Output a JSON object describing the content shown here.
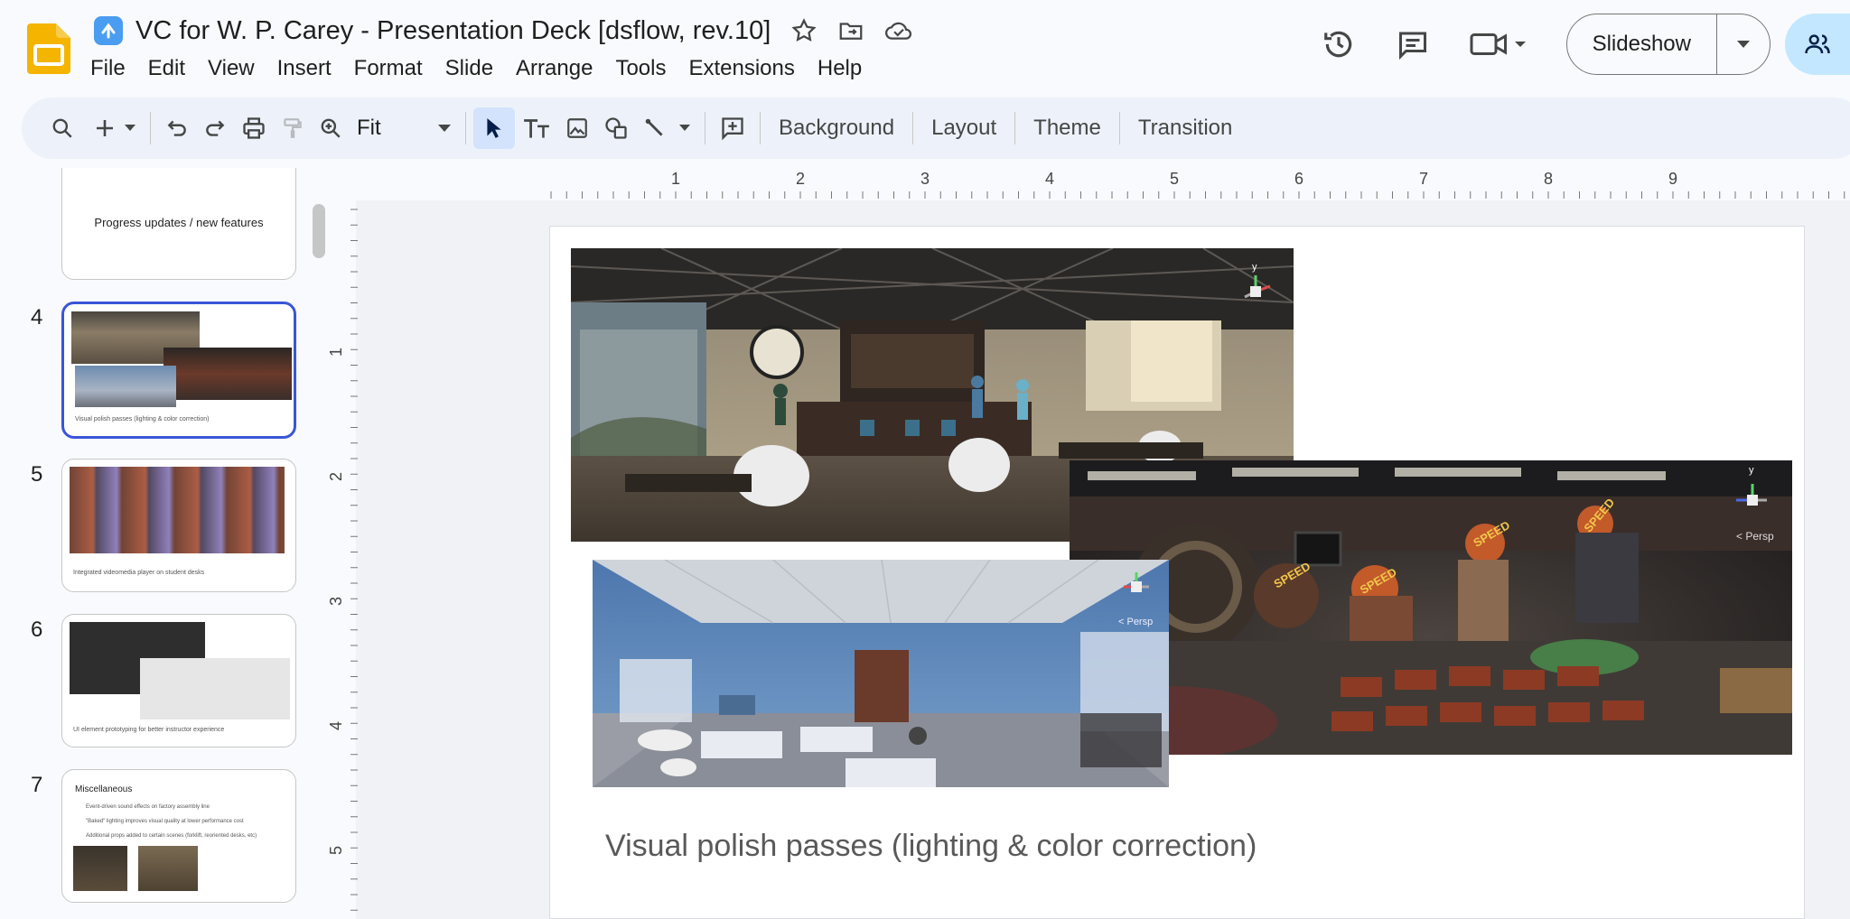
{
  "document": {
    "title": "VC for W. P. Carey - Presentation Deck [dsflow, rev.10]"
  },
  "menu": [
    "File",
    "Edit",
    "View",
    "Insert",
    "Format",
    "Slide",
    "Arrange",
    "Tools",
    "Extensions",
    "Help"
  ],
  "header": {
    "slideshow_label": "Slideshow"
  },
  "toolbar": {
    "zoom_value": "Fit",
    "background_label": "Background",
    "layout_label": "Layout",
    "theme_label": "Theme",
    "transition_label": "Transition"
  },
  "filmstrip": {
    "slides": [
      {
        "number": "",
        "caption": "Progress updates / new features"
      },
      {
        "number": "4",
        "caption": "Visual polish passes (lighting & color correction)"
      },
      {
        "number": "5",
        "caption": "Integrated videomedia player on student desks"
      },
      {
        "number": "6",
        "caption": "UI element prototyping for better instructor experience"
      },
      {
        "number": "7",
        "title": "Miscellaneous",
        "bullets": [
          "Event-driven sound effects on factory assembly line",
          "\"Baked\" lighting improves visual quality at lower performance cost",
          "Additional props added to certain scenes (forklift, reoriented desks, etc)"
        ]
      }
    ]
  },
  "ruler": {
    "horizontal": [
      "1",
      "2",
      "3",
      "4",
      "5",
      "6",
      "7",
      "8",
      "9"
    ],
    "vertical": [
      "1",
      "2",
      "3",
      "4",
      "5"
    ]
  },
  "slide": {
    "caption": "Visual polish passes (lighting & color correction)",
    "overlay_labels": {
      "persp": "< Persp",
      "speed": "SPEED",
      "y_axis": "y"
    }
  },
  "colors": {
    "accent": "#3a55d8",
    "share_bg": "#c2e7ff",
    "toolbar_bg": "#edf2fa"
  }
}
